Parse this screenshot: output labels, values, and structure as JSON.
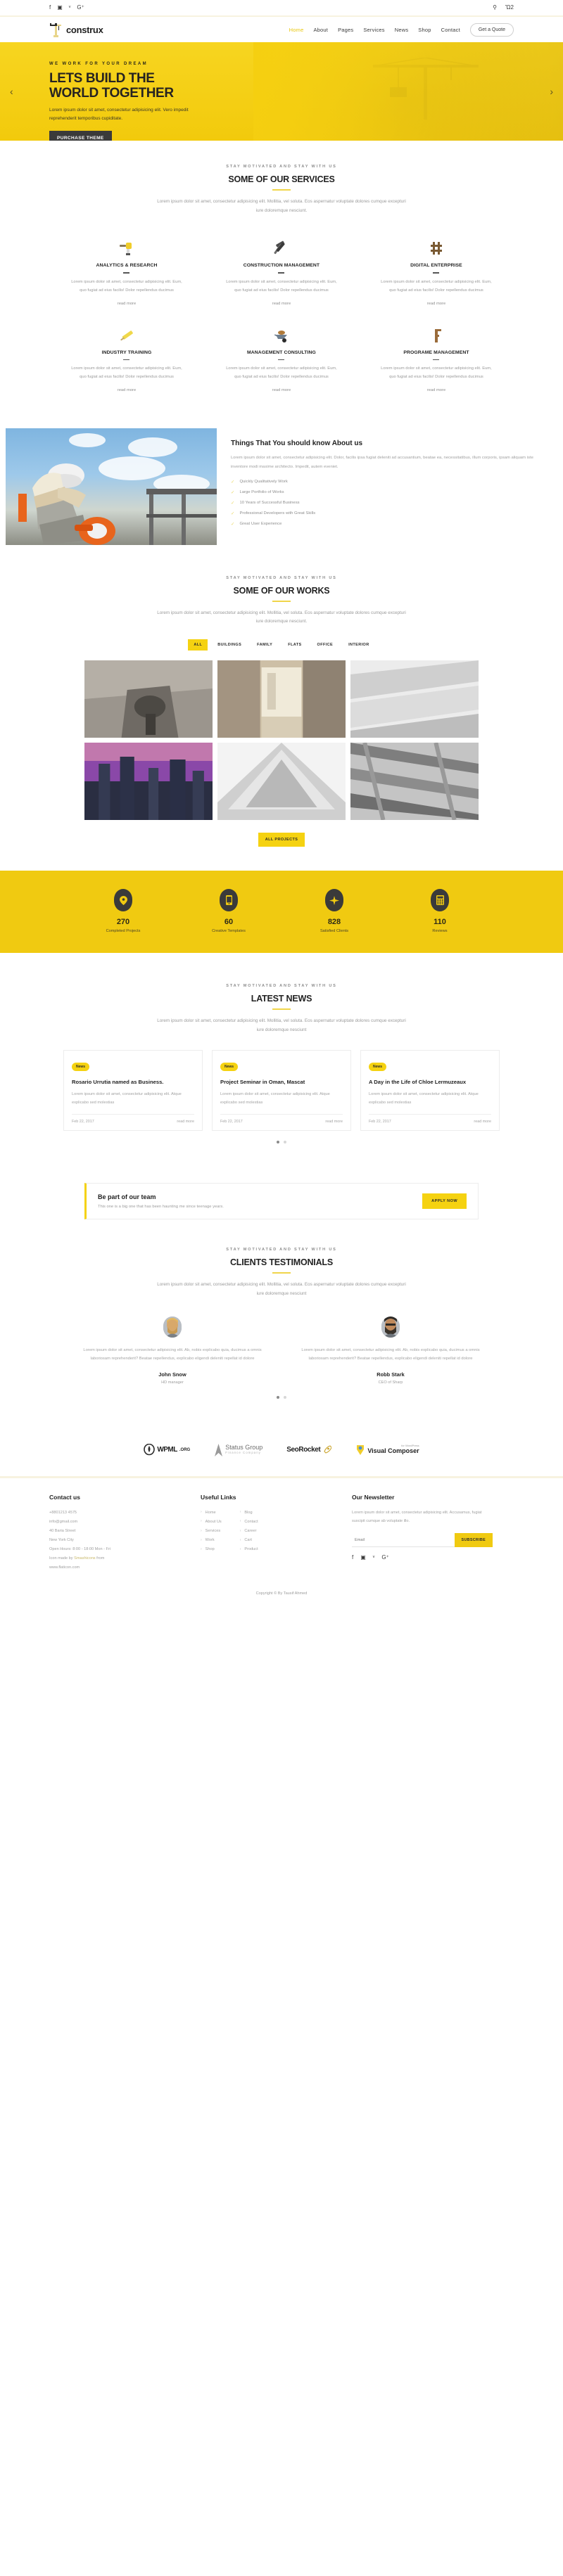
{
  "topbar": {
    "social": [
      {
        "name": "facebook-icon",
        "glyph": "f"
      },
      {
        "name": "instagram-icon",
        "glyph": "▣"
      },
      {
        "name": "twitter-icon",
        "glyph": "ᵛ"
      },
      {
        "name": "google-plus-icon",
        "glyph": "G⁺"
      }
    ],
    "search_icon": "⚲",
    "cart_icon": "Ὥ2"
  },
  "header": {
    "brand": "construx",
    "nav": [
      {
        "label": "Home",
        "active": true
      },
      {
        "label": "About",
        "active": false
      },
      {
        "label": "Pages",
        "active": false
      },
      {
        "label": "Services",
        "active": false
      },
      {
        "label": "News",
        "active": false
      },
      {
        "label": "Shop",
        "active": false
      },
      {
        "label": "Contact",
        "active": false
      }
    ],
    "quote_button": "Get a Quote"
  },
  "hero": {
    "kicker": "WE WORK FOR YOUR DREAM",
    "title_line1": "LETS BUILD THE",
    "title_line2": "WORLD TOGETHER",
    "text": "Lorem ipsum dolor sit amet, consectetur adipisicing elit. Vero impedit reprehenderit temporibus cupiditate.",
    "cta": "PURCHASE THEME",
    "prev_arrow": "‹",
    "next_arrow": "›"
  },
  "services_section": {
    "kicker": "STAY MOTIVATED AND STAY WITH US",
    "title": "SOME OF OUR SERVICES",
    "sub": "Lorem ipsum dolor sit amet, consectetur adipisicing elit. Mollitia, vel soluta. Eos aspernatur voluptate dolores cumque excepturi iure doloremque nesciunt.",
    "read_more": "read more",
    "items": [
      {
        "icon": "drill-icon",
        "title": "ANALYTICS & RESEARCH",
        "text": "Lorem ipsum dolor sit amet, consectetur adipisicing elit. Eum, quo fugiat ad eius facilis! Dolor repellendus ducimus"
      },
      {
        "icon": "hammer-icon",
        "title": "CONSTRUCTION MANAGEMENT",
        "text": "Lorem ipsum dolor sit amet, consectetur adipisicing elit. Eum, quo fugiat ad eius facilis! Dolor repellendus ducimus"
      },
      {
        "icon": "scaffold-icon",
        "title": "DIGITAL ENTERPRISE",
        "text": "Lorem ipsum dolor sit amet, consectetur adipisicing elit. Eum, quo fugiat ad eius facilis! Dolor repellendus ducimus"
      },
      {
        "icon": "saw-icon",
        "title": "INDUSTRY TRAINING",
        "text": "Lorem ipsum dolor sit amet, consectetur adipisicing elit. Eum, quo fugiat ad eius facilis! Dolor repellendus ducimus"
      },
      {
        "icon": "wheelbarrow-icon",
        "title": "MANAGEMENT CONSULTING",
        "text": "Lorem ipsum dolor sit amet, consectetur adipisicing elit. Eum, quo fugiat ad eius facilis! Dolor repellendus ducimus"
      },
      {
        "icon": "wrench-icon",
        "title": "PROGRAME MANAGEMENT",
        "text": "Lorem ipsum dolor sit amet, consectetur adipisicing elit. Eum, quo fugiat ad eius facilis! Dolor repellendus ducimus"
      }
    ]
  },
  "about": {
    "title": "Things That You should know About us",
    "text": "Lorem ipsum dolor sit amet, consectetur adipisicing elit. Dolor, facilis ipsa fugiat deleniti ad accusantium, beatae ea, necessitatibus, illum corporis, ipsam aliquam iste inventore modi maxime architecto. Impedit, autem eveniet.",
    "list": [
      "Quickly Qualitatively Work",
      "Large Portfolio of Works",
      "10 Years of Successful Business",
      "Professional Developers with Great Skills",
      "Great User Experience"
    ]
  },
  "works_section": {
    "kicker": "STAY MOTIVATED AND STAY WITH US",
    "title": "SOME OF OUR WORKS",
    "sub": "Lorem ipsum dolor sit amet, consectetur adipisicing elit. Mollitia, vel soluta. Eos aspernatur voluptate dolores cumque excepturi iure doloremque nesciunt.",
    "filters": [
      {
        "label": "ALL",
        "active": true
      },
      {
        "label": "BUILDINGS",
        "active": false
      },
      {
        "label": "FAMILY",
        "active": false
      },
      {
        "label": "FLATS",
        "active": false
      },
      {
        "label": "OFFICE",
        "active": false
      },
      {
        "label": "INTERIOR",
        "active": false
      }
    ],
    "all_projects_button": "ALL PROJECTS"
  },
  "counters": [
    {
      "icon": "map-pin-icon",
      "glyph": "●",
      "number": "270",
      "label": "Completed Projects"
    },
    {
      "icon": "mobile-icon",
      "glyph": "▯",
      "number": "60",
      "label": "Creative Templates"
    },
    {
      "icon": "plane-icon",
      "glyph": "✈",
      "number": "828",
      "label": "Satisfied Clients"
    },
    {
      "icon": "calculator-icon",
      "glyph": "▦",
      "number": "110",
      "label": "Reviews"
    }
  ],
  "news_section": {
    "kicker": "STAY MOTIVATED AND STAY WITH US",
    "title": "LATEST NEWS",
    "sub": "Lorem ipsum dolor sit amet, consectetur adipisicing elit. Mollitia, vel soluta. Eos aspernatur voluptate dolores cumque excepturi iure doloremque nesciunt",
    "cards": [
      {
        "badge": "News",
        "title": "Rosario Urrutia named as Business.",
        "text": "Lorem ipsum dolor sit amet, consectetur adipisicing elit. Atque explicabo sed molestias",
        "date": "Feb 22, 2017",
        "read_more": "read more"
      },
      {
        "badge": "News",
        "title": "Project Seminar in Oman, Mascat",
        "text": "Lorem ipsum dolor sit amet, consectetur adipisicing elit. Atque explicabo sed molestias",
        "date": "Feb 22, 2017",
        "read_more": "read more"
      },
      {
        "badge": "News",
        "title": "A Day in the Life of Chloe Lermuzeaux",
        "text": "Lorem ipsum dolor sit amet, consectetur adipisicing elit. Atque explicabo sed molestias",
        "date": "Feb 22, 2017",
        "read_more": "read more"
      }
    ]
  },
  "team_cta": {
    "title": "Be part of our team",
    "text": "This one is a big one that has been haunting me since teenage years.",
    "button": "APPLY NOW"
  },
  "testimonials_section": {
    "kicker": "STAY MOTIVATED AND STAY WITH US",
    "title": "CLIENTS TESTIMONIALS",
    "sub": "Lorem ipsum dolor sit amet, consectetur adipisicing elit. Mollitia, vel soluta. Eos aspernatur voluptate dolores cumque excepturi iure doloremque nesciunt",
    "items": [
      {
        "text": "Lorem ipsum dolor sit amet, consectetur adipisicing elit. Ab, nobis explicabo quia, ducimus a omnis laboriosam reprehenderit? Beatae repellendus, explicabo eligendi deleniti repellat id dolore",
        "name": "John Snow",
        "role": "HD manager"
      },
      {
        "text": "Lorem ipsum dolor sit amet, consectetur adipisicing elit. Ab, nobis explicabo quia, ducimus a omnis laboriosam reprehenderit? Beatae repellendus, explicabo eligendi deleniti repellat id dolore",
        "name": "Robb Stark",
        "role": "CEO of Sharp"
      }
    ]
  },
  "clients": [
    {
      "name": "wpml-logo",
      "text": "WPML",
      "suffix": ".ORG"
    },
    {
      "name": "status-group-logo",
      "text": "Status Group",
      "suffix": "Finance Company"
    },
    {
      "name": "seorocket-logo",
      "text": "SeoRocket",
      "suffix": ""
    },
    {
      "name": "visual-composer-logo",
      "text": "Visual Composer",
      "suffix": "for WordPress"
    }
  ],
  "footer": {
    "contact": {
      "heading": "Contact us",
      "lines": [
        "+8801213 4575",
        "info@gmail.com",
        "40 Baria Street",
        "New York City",
        "Open Hours: 8:00 - 18:00 Mon - Fri"
      ],
      "credit_prefix": "Icon made by ",
      "credit_link": "Smashicons",
      "credit_suffix": " from",
      "credit_site": "www.flaticon.com"
    },
    "links": {
      "heading": "Useful Links",
      "col1": [
        "Home",
        "About Us",
        "Services",
        "Work",
        "Shop"
      ],
      "col2": [
        "Blog",
        "Contact",
        "Career",
        "Cart",
        "Product"
      ]
    },
    "newsletter": {
      "heading": "Our Newsletter",
      "text": "Lorem ipsum dolor sit amet, consectetur adipisicing elit. Accusamus, fugiat suscipit cumque ab voluptate illo.",
      "placeholder": "Email",
      "value": "",
      "button": "SUBSCRIBE",
      "social": [
        {
          "name": "facebook-icon",
          "glyph": "f"
        },
        {
          "name": "instagram-icon",
          "glyph": "▣"
        },
        {
          "name": "twitter-icon",
          "glyph": "ᵛ"
        },
        {
          "name": "google-plus-icon",
          "glyph": "G⁺"
        }
      ]
    },
    "copyright": "Copyright © By Tausif Ahmed"
  },
  "colors": {
    "accent": "#f5d211",
    "hero_bg": "#f5cf10",
    "counter_bg": "#f0ca11",
    "dark": "#3a3a3a"
  }
}
